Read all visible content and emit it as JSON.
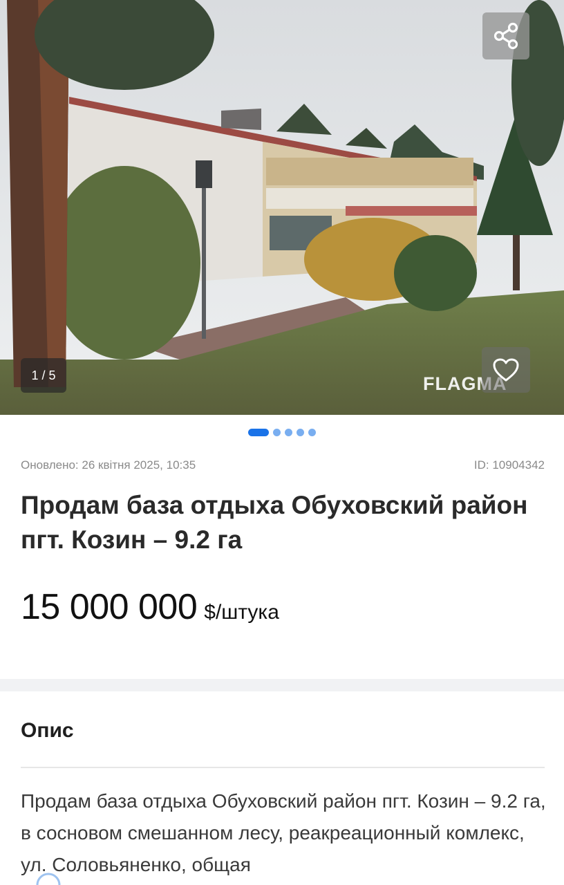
{
  "gallery": {
    "counter": "1 / 5",
    "watermark": "FLAGMA",
    "slide_count": 5,
    "active_slide": 1,
    "share_icon": "share-icon",
    "favorite_icon": "heart-outline-icon"
  },
  "listing": {
    "updated": "Оновлено: 26 квітня 2025, 10:35",
    "id": "ID: 10904342",
    "title": "Продам база отдыха Обуховский район пгт. Козин – 9.2 га",
    "price_value": "15 000 000",
    "price_unit": "$/штука"
  },
  "description": {
    "heading": "Опис",
    "text": "Продам база отдыха Обуховский район пгт. Козин – 9.2 га, в сосновом смешанном лесу, реакреационный комлекс, ул. Соловьяненко, общая"
  },
  "colors": {
    "accent": "#1a73e8",
    "dot_inactive": "#79aef0",
    "meta_text": "#8a8a8a",
    "separator": "#f1f2f4"
  }
}
